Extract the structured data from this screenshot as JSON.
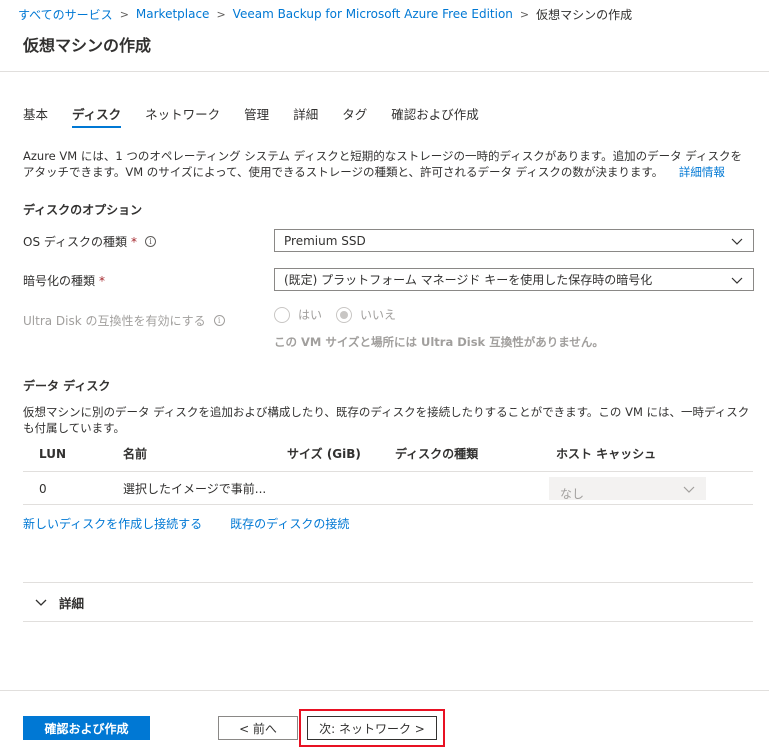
{
  "breadcrumb": {
    "items": [
      "すべてのサービス",
      "Marketplace",
      "Veeam Backup for Microsoft Azure Free Edition"
    ],
    "current": "仮想マシンの作成",
    "separator": ">"
  },
  "page_title": "仮想マシンの作成",
  "tabs": [
    {
      "label": "基本"
    },
    {
      "label": "ディスク"
    },
    {
      "label": "ネットワーク"
    },
    {
      "label": "管理"
    },
    {
      "label": "詳細"
    },
    {
      "label": "タグ"
    },
    {
      "label": "確認および作成"
    }
  ],
  "active_tab": "ディスク",
  "description": {
    "text": "Azure VM には、1 つのオペレーティング システム ディスクと短期的なストレージの一時的ディスクがあります。追加のデータ ディスクをアタッチできます。VM のサイズによって、使用できるストレージの種類と、許可されるデータ ディスクの数が決まります。",
    "link": "詳細情報"
  },
  "disk_options": {
    "heading": "ディスクのオプション",
    "os_disk_type": {
      "label": "OS ディスクの種類",
      "required": "*",
      "value": "Premium SSD"
    },
    "encryption_type": {
      "label": "暗号化の種類",
      "required": "*",
      "value": "(既定) プラットフォーム マネージド キーを使用した保存時の暗号化"
    },
    "ultra_disk": {
      "label": "Ultra Disk の互換性を有効にする",
      "options": [
        "はい",
        "いいえ"
      ],
      "selected": "いいえ",
      "note": "この VM サイズと場所には Ultra Disk 互換性がありません。"
    }
  },
  "data_disks": {
    "heading": "データ ディスク",
    "description": "仮想マシンに別のデータ ディスクを追加および構成したり、既存のディスクを接続したりすることができます。この VM には、一時ディスクも付属しています。",
    "columns": [
      "LUN",
      "名前",
      "サイズ (GiB)",
      "ディスクの種類",
      "ホスト キャッシュ"
    ],
    "rows": [
      {
        "lun": "0",
        "name": "選択したイメージで事前...",
        "size": "",
        "type": "",
        "cache": "なし"
      }
    ],
    "link_create": "新しいディスクを作成し接続する",
    "link_attach": "既存のディスクの接続"
  },
  "details_section": {
    "label": "詳細"
  },
  "footer": {
    "review_create": "確認および作成",
    "previous": "< 前へ",
    "next": "次: ネットワーク >"
  },
  "colors": {
    "accent": "#0078d4",
    "required": "#a4262c",
    "highlight": "#e81123"
  }
}
